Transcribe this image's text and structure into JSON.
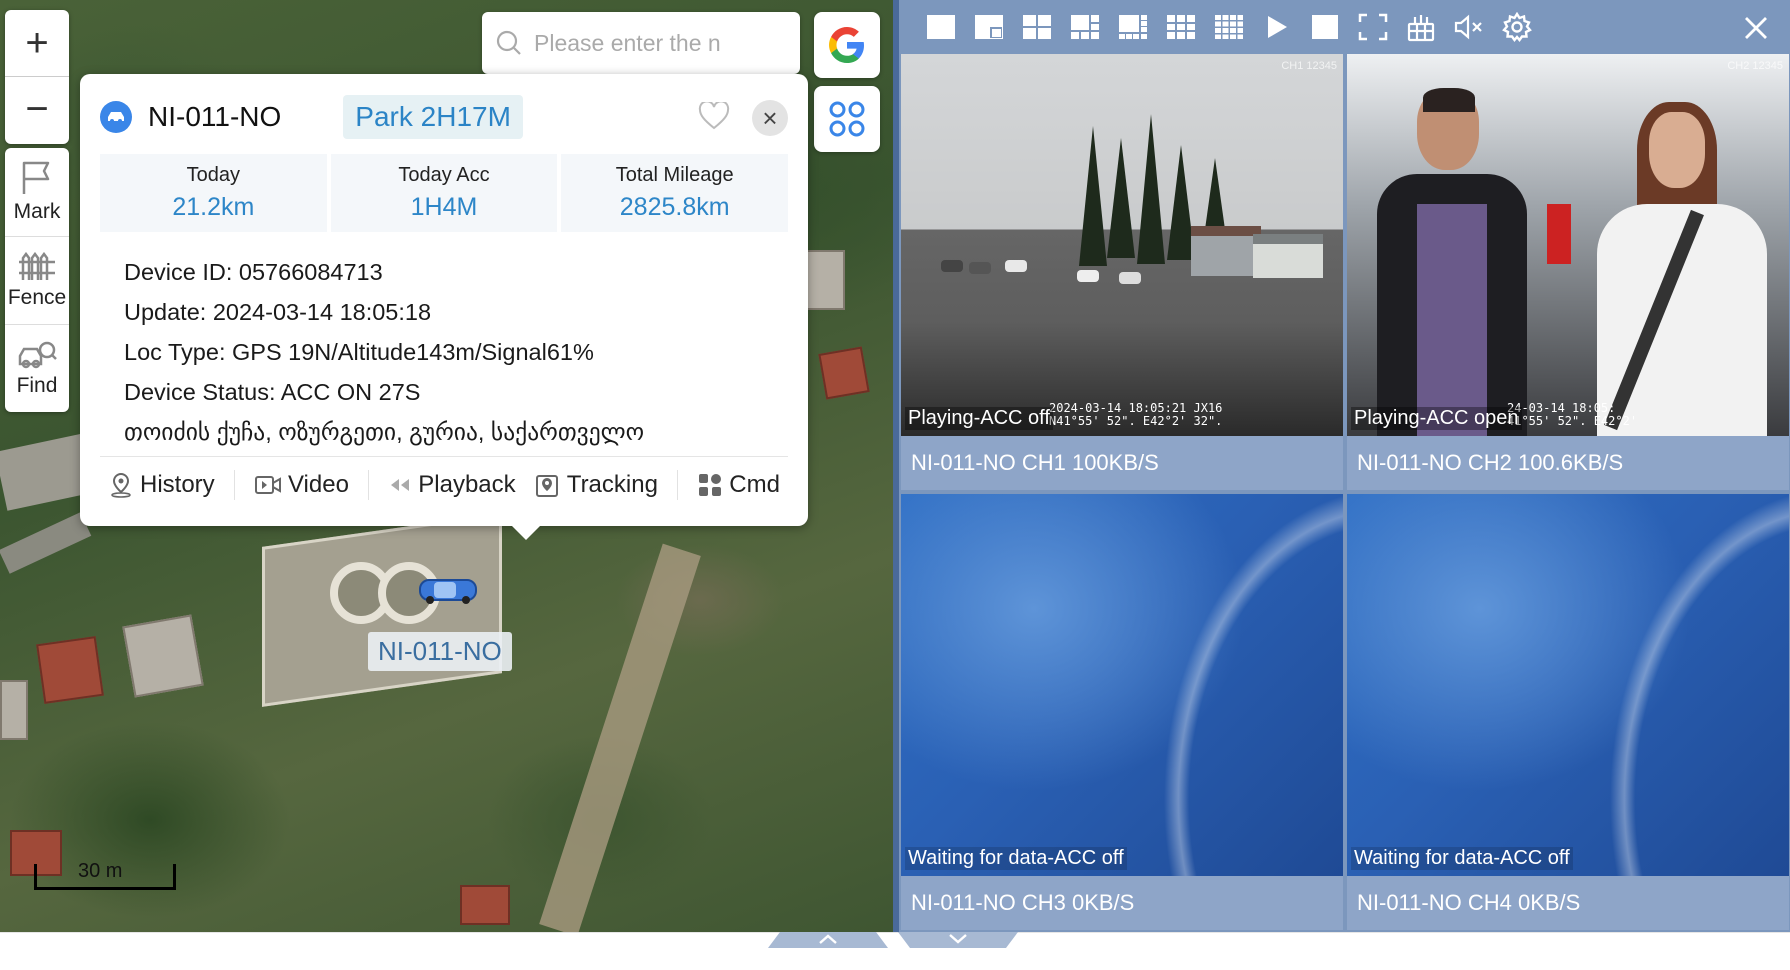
{
  "map": {
    "zoom_in": "+",
    "zoom_out": "−",
    "tools": [
      {
        "label": "Mark",
        "icon": "flag-icon"
      },
      {
        "label": "Fence",
        "icon": "fence-icon"
      },
      {
        "label": "Find",
        "icon": "car-search-icon"
      }
    ],
    "search_placeholder": "Please enter the n",
    "marker_label": "NI-011-NO",
    "scale": "30 m"
  },
  "popup": {
    "plate": "NI-011-NO",
    "park_status": "Park 2H17M",
    "stats": [
      {
        "label": "Today",
        "value": "21.2km"
      },
      {
        "label": "Today Acc",
        "value": "1H4M"
      },
      {
        "label": "Total Mileage",
        "value": "2825.8km"
      }
    ],
    "device_id": "Device ID: 05766084713",
    "update": "Update: 2024-03-14 18:05:18",
    "loc_type": "Loc Type: GPS 19N/Altitude143m/Signal61%",
    "device_status": "Device Status: ACC ON 27S",
    "address": "თოიძის ქუჩა, ოზურგეთი, გურია, საქართველო",
    "actions": {
      "history": "History",
      "video": "Video",
      "playback": "Playback",
      "tracking": "Tracking",
      "cmd": "Cmd"
    }
  },
  "video": {
    "channels": [
      {
        "status": "Playing-ACC off",
        "footer": "NI-011-NO CH1 100KB/S",
        "mark": "CH1 12345",
        "ts1": "2024-03-14 18:05:21 JX16",
        "ts2": "N41°55' 52\". E42°2' 32\"."
      },
      {
        "status": "Playing-ACC open",
        "footer": "NI-011-NO CH2 100.6KB/S",
        "mark": "CH2 12345",
        "ts1": "24-03-14 18:05:",
        "ts2": "41°55' 52\". E42°2'"
      },
      {
        "status": "Waiting for data-ACC off",
        "footer": "NI-011-NO CH3 0KB/S"
      },
      {
        "status": "Waiting for data-ACC off",
        "footer": "NI-011-NO CH4 0KB/S"
      }
    ]
  },
  "colors": {
    "accent": "#2d86c8",
    "panel": "#7c97bd",
    "footer": "#8ea5c8"
  }
}
